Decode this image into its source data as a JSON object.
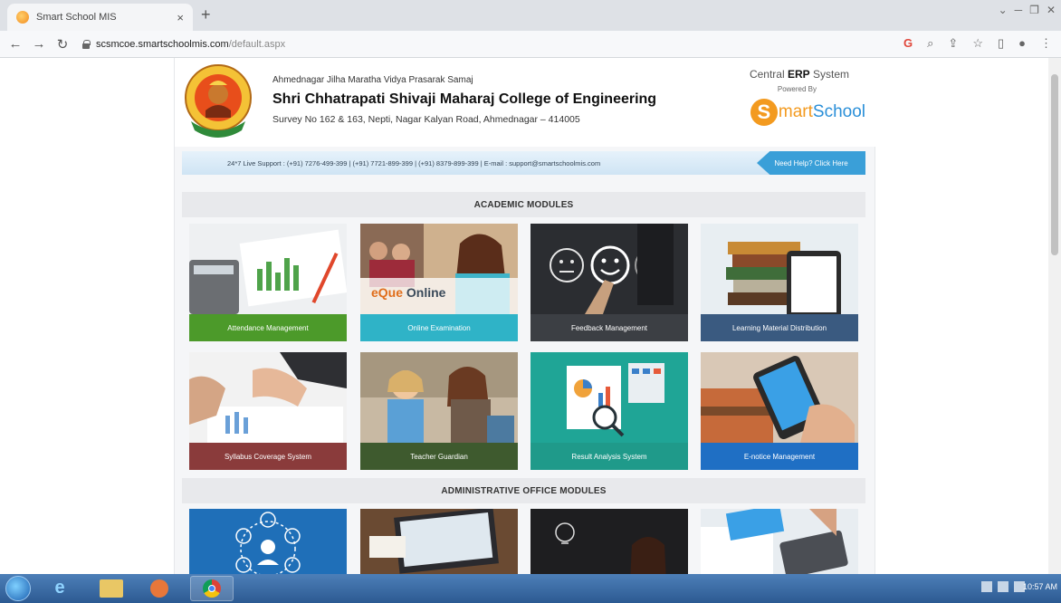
{
  "browser": {
    "tab_title": "Smart School MIS",
    "tab_close": "×",
    "new_tab": "+",
    "url_host": "scsmcoe.smartschoolmis.com",
    "url_path": "/default.aspx"
  },
  "header": {
    "society": "Ahmednagar Jilha Maratha Vidya Prasarak Samaj",
    "college": "Shri Chhatrapati Shivaji Maharaj College of Engineering",
    "address": "Survey No 162 & 163, Nepti, Nagar Kalyan Road, Ahmednagar – 414005",
    "erp_prefix": "Central ",
    "erp_bold": "ERP",
    "erp_suffix": " System",
    "powered_by": "Powered By",
    "brand_s": "S",
    "brand_mart": "mart",
    "brand_school": "School"
  },
  "support": {
    "text": "24*7 Live Support : (+91) 7276-499-399 | (+91) 7721-899-399 | (+91) 8379-899-399 | E-mail : support@smartschoolmis.com",
    "help_button": "Need Help? Click Here"
  },
  "sections": {
    "academic": "ACADEMIC MODULES",
    "admin": "ADMINISTRATIVE OFFICE MODULES"
  },
  "academic_modules": [
    {
      "label": "Attendance Management",
      "color": "#4c9a2a"
    },
    {
      "label": "Online Examination",
      "color": "#2fb3c7",
      "overlay": "eQue Online"
    },
    {
      "label": "Feedback Management",
      "color": "#3c3f44"
    },
    {
      "label": "Learning Material Distribution",
      "color": "#3a5a80"
    },
    {
      "label": "Syllabus Coverage System",
      "color": "#8a3b3b"
    },
    {
      "label": "Teacher Guardian",
      "color": "#3e5a2e"
    },
    {
      "label": "Result Analysis System",
      "color": "#1f9a8a"
    },
    {
      "label": "E-notice Management",
      "color": "#1f6fc4"
    }
  ],
  "taskbar": {
    "time": "10:57 AM"
  }
}
